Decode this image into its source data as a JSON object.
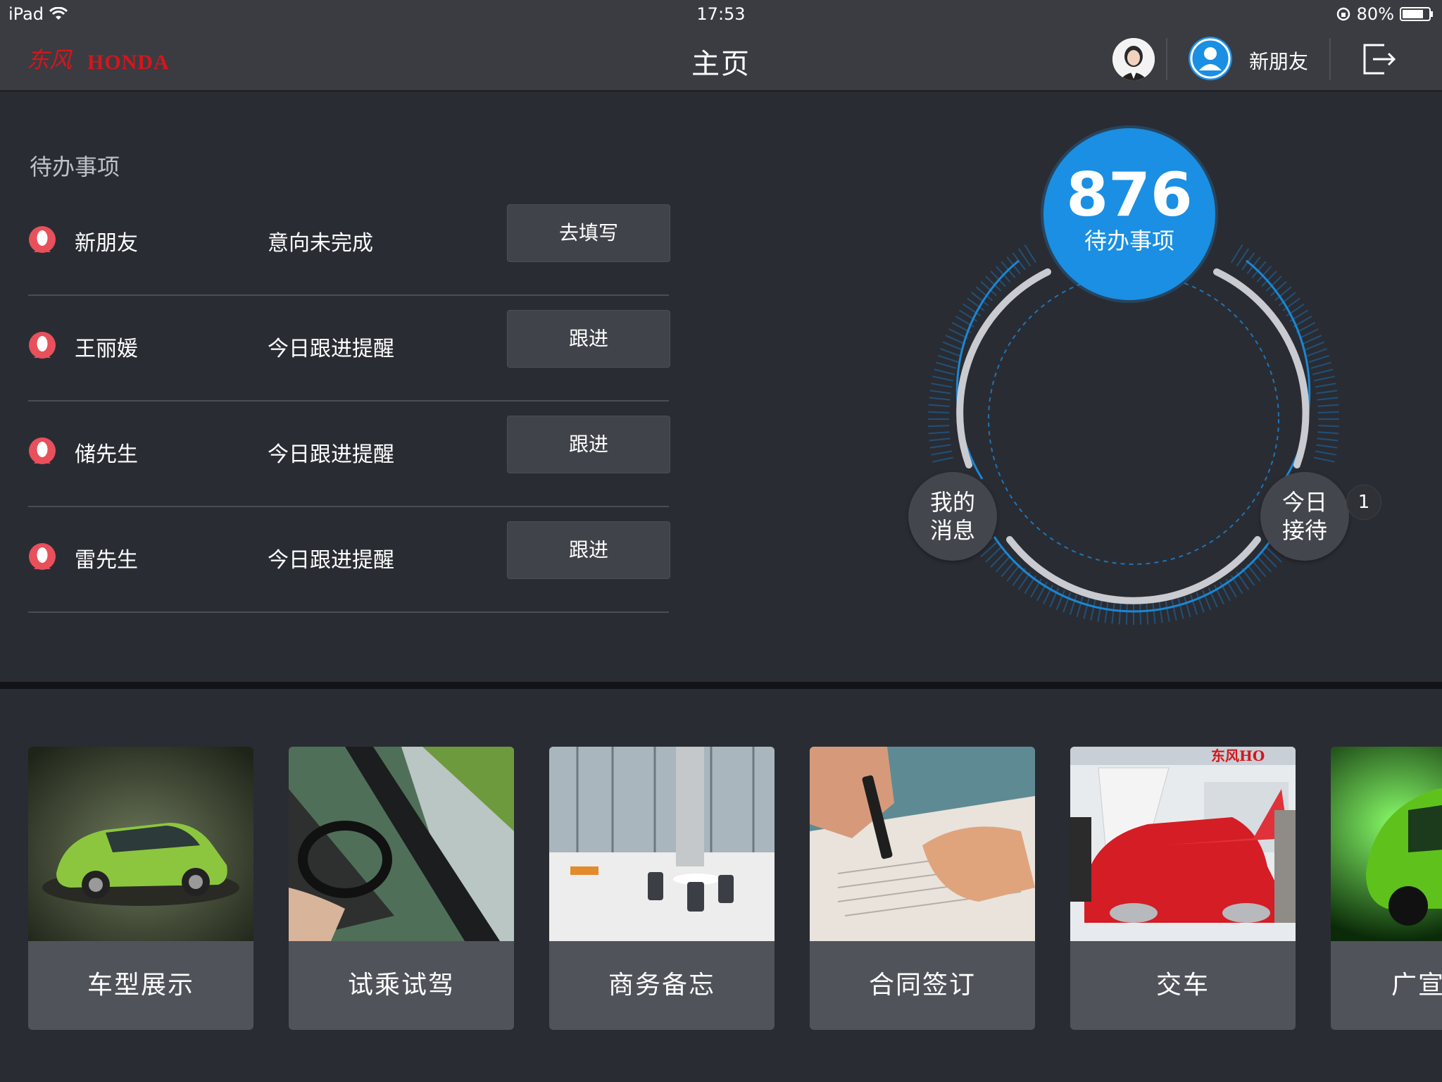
{
  "status_bar": {
    "device": "iPad",
    "time": "17:53",
    "battery": "80%",
    "battery_level": 0.8
  },
  "nav": {
    "brand": "HONDA",
    "title": "主页",
    "username": "新朋友"
  },
  "todo": {
    "heading": "待办事项",
    "items": [
      {
        "name": "新朋友",
        "status": "意向未完成",
        "action": "去填写"
      },
      {
        "name": "王丽媛",
        "status": "今日跟进提醒",
        "action": "跟进"
      },
      {
        "name": "储先生",
        "status": "今日跟进提醒",
        "action": "跟进"
      },
      {
        "name": "雷先生",
        "status": "今日跟进提醒",
        "action": "跟进"
      }
    ]
  },
  "dial": {
    "count": "876",
    "label": "待办事项",
    "messages_line1": "我的",
    "messages_line2": "消息",
    "reception_line1": "今日",
    "reception_line2": "接待",
    "reception_badge": "1"
  },
  "modules": [
    {
      "label": "车型展示"
    },
    {
      "label": "试乘试驾"
    },
    {
      "label": "商务备忘"
    },
    {
      "label": "合同签订"
    },
    {
      "label": "交车"
    },
    {
      "label": "广宣"
    }
  ],
  "colors": {
    "accent": "#1a8fe3",
    "brand_red": "#d4161c",
    "background": "#2a2c33",
    "nav_bar": "#3a3c42",
    "person_icon": "#e8505b"
  }
}
